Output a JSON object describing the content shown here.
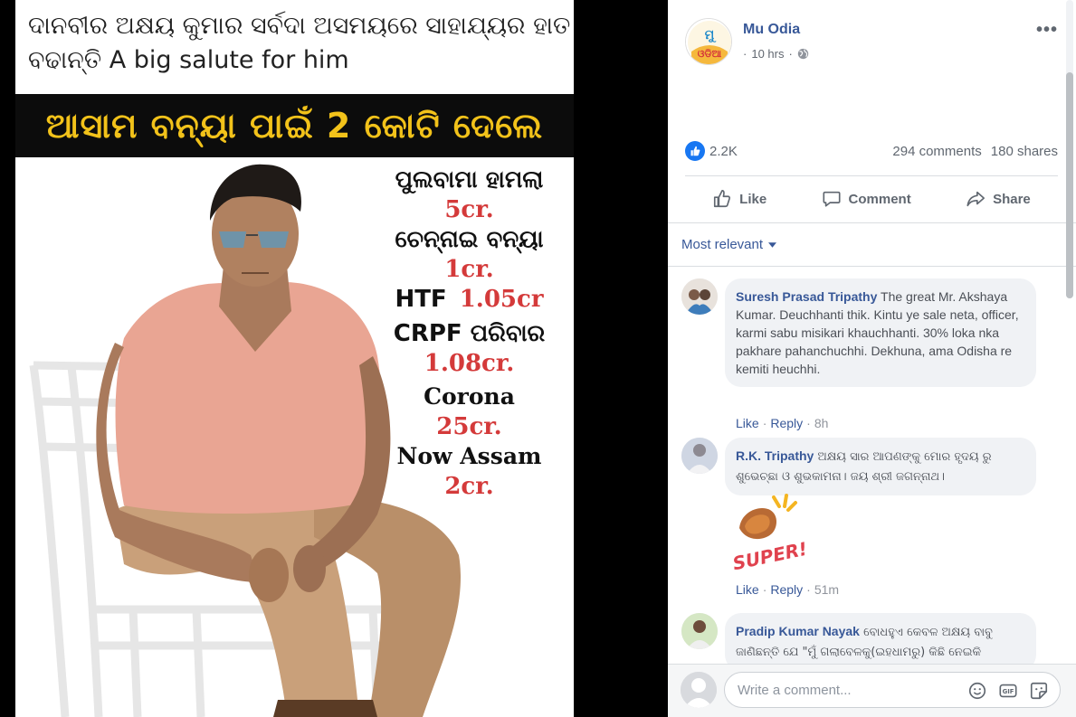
{
  "photo": {
    "caption_line1": "ଦାନବୀର ଅକ୍ଷୟ କୁମାର ସର୍ବଦା ଅସମୟରେ ସାହାଯ୍ୟର ହାତ",
    "caption_line2": "ବଢାନ୍ତି A big salute for him",
    "banner": "ଆସାମ ବନ୍ୟା ପାଇଁ 2 କୋଟି ଦେଲେ",
    "donations": [
      {
        "label": "ପୁଲବାମା ହାମଲା",
        "amount": "5cr."
      },
      {
        "label": "ଚେନ୍ନାଇ ବନ୍ୟା",
        "amount": "1cr."
      },
      {
        "label": "HTF",
        "amount": "1.05cr"
      },
      {
        "label": "CRPF ପରିବାର",
        "amount": "1.08cr."
      },
      {
        "label": "Corona",
        "amount": "25cr."
      },
      {
        "label": "Now Assam",
        "amount": "2cr."
      }
    ]
  },
  "post": {
    "page_name": "Mu Odia",
    "time": "10 hrs",
    "meta_sep": "·",
    "more": "•••",
    "avatar_text": "ମୁ ଓଡିଆ",
    "like_count": "2.2K",
    "comments_count": "294 comments",
    "shares_count": "180 shares",
    "actions": {
      "like": "Like",
      "comment": "Comment",
      "share": "Share"
    },
    "sort_label": "Most relevant"
  },
  "comments": [
    {
      "author": "Suresh Prasad Tripathy",
      "text": " The great Mr. Akshaya Kumar. Deuchhanti thik. Kintu ye sale neta, officer, karmi sabu misikari khauchhanti. 30% loka nka pakhare pahanchuchhi. Dekhuna, ama Odisha re kemiti heuchhi.",
      "like": "Like",
      "reply": "Reply",
      "time": "8h"
    },
    {
      "author": "R.K. Tripathy",
      "text": " ଅକ୍ଷୟ ସାର ଆପଣଙ୍କୁ ମୋର ହୃଦୟ ରୁ ଶୁଭେଚ୍ଛା ଓ ଶୁଭକାମନା। ଜୟ ଶ୍ରୀ ଜଗନ୍ନାଥ।",
      "sticker": "SUPER!",
      "like": "Like",
      "reply": "Reply",
      "time": "51m"
    },
    {
      "author": "Pradip Kumar Nayak",
      "text": " ବୋଧହୁଏ କେବଳ ଅକ୍ଷୟ ବାବୁ ଜାଣିଛନ୍ତି ଯେ \"ମୁଁ ଗଲାବେଳକୁ(ଇହଧାମରୁ) କିଛି ନେଇକି"
    }
  ],
  "composer": {
    "placeholder": "Write a comment..."
  },
  "colors": {
    "link": "#385898",
    "banner_text": "#f2c21a",
    "amount": "#d43a3a",
    "like_blue": "#1877f2"
  }
}
